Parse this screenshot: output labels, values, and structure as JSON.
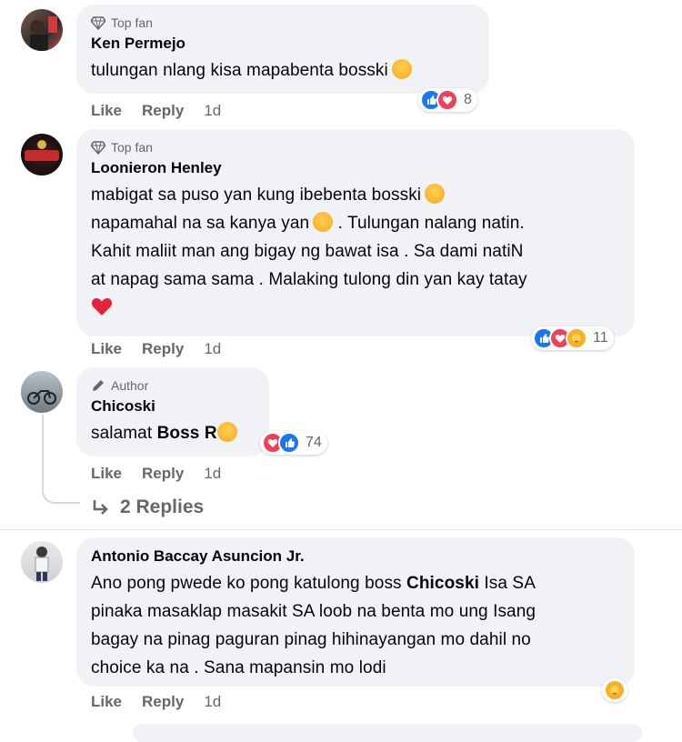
{
  "comments": [
    {
      "badge": "Top fan",
      "name": "Ken Permejo",
      "lines": [
        "tulungan nlang kisa mapabenta bosski"
      ],
      "reaction_count": "8",
      "actions": {
        "like": "Like",
        "reply": "Reply",
        "time": "1d"
      }
    },
    {
      "badge": "Top fan",
      "name": "Loonieron Henley",
      "lines": [
        "mabigat sa puso yan kung ibebenta bosski",
        "napamahal na sa kanya yan",
        ". Tulungan nalang natin.",
        "Kahit maliit man ang bigay ng bawat isa . Sa dami natiN",
        "at napag sama sama . Malaking tulong din yan kay tatay"
      ],
      "reaction_count": "11",
      "actions": {
        "like": "Like",
        "reply": "Reply",
        "time": "1d"
      }
    },
    {
      "badge": "Author",
      "name": "Chicoski",
      "text_prefix": "salamat ",
      "mention": "Boss R",
      "reaction_count": "74",
      "actions": {
        "like": "Like",
        "reply": "Reply",
        "time": "1d"
      }
    },
    {
      "name": "Antonio Baccay Asuncion Jr.",
      "line1_prefix": "Ano pong pwede ko pong katulong boss ",
      "mention": "Chicoski",
      "line1_suffix": " Isa SA",
      "lines": [
        "pinaka masaklap masakit SA loob na benta mo ung Isang",
        "bagay na pinag paguran pinag hihinayangan mo dahil no",
        "choice ka na . Sana mapansin mo lodi"
      ],
      "actions": {
        "like": "Like",
        "reply": "Reply",
        "time": "1d"
      }
    }
  ],
  "replies_link": "2 Replies",
  "colors": {
    "bubble": "#f0f2f5",
    "secondary_text": "#65676b",
    "like": "#1877f2",
    "love": "#f33e58"
  }
}
